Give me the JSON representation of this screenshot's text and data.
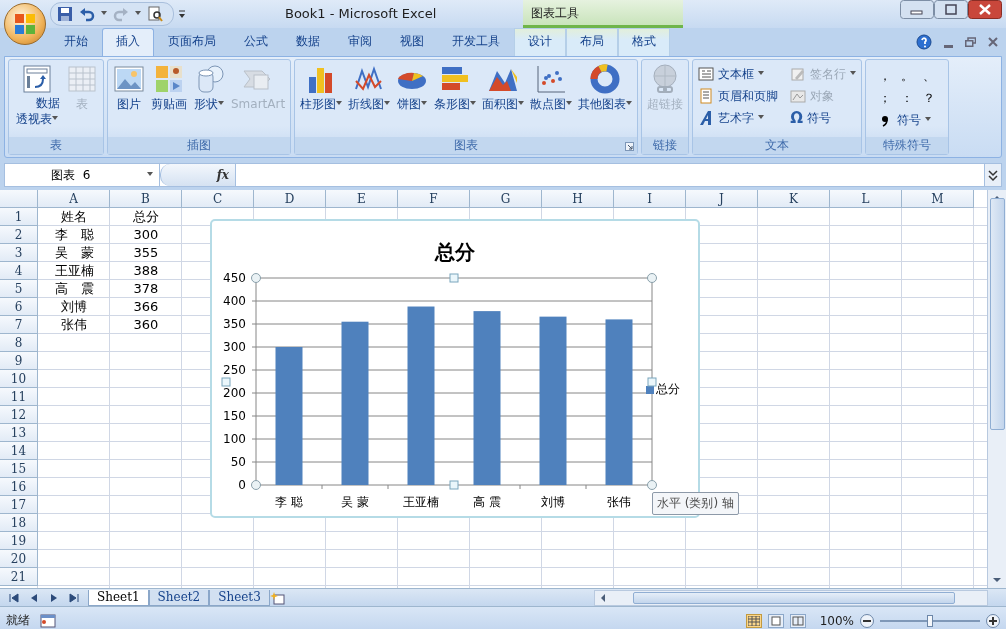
{
  "window": {
    "title": "Book1 - Microsoft Excel",
    "context_group": "图表工具"
  },
  "ribbon_tabs": [
    {
      "label": "开始",
      "selected": false,
      "contextual": false
    },
    {
      "label": "插入",
      "selected": true,
      "contextual": false
    },
    {
      "label": "页面布局",
      "selected": false,
      "contextual": false
    },
    {
      "label": "公式",
      "selected": false,
      "contextual": false
    },
    {
      "label": "数据",
      "selected": false,
      "contextual": false
    },
    {
      "label": "审阅",
      "selected": false,
      "contextual": false
    },
    {
      "label": "视图",
      "selected": false,
      "contextual": false
    },
    {
      "label": "开发工具",
      "selected": false,
      "contextual": false
    },
    {
      "label": "设计",
      "selected": false,
      "contextual": true
    },
    {
      "label": "布局",
      "selected": false,
      "contextual": true
    },
    {
      "label": "格式",
      "selected": false,
      "contextual": true
    }
  ],
  "ribbon_groups": [
    {
      "label": "表",
      "kind": "large",
      "buttons": [
        {
          "label": "数据透视表",
          "dropdown": true,
          "disabled": false
        },
        {
          "label": "表",
          "dropdown": false,
          "disabled": true
        }
      ]
    },
    {
      "label": "插图",
      "kind": "large",
      "buttons": [
        {
          "label": "图片",
          "dropdown": false,
          "disabled": false
        },
        {
          "label": "剪贴画",
          "dropdown": false,
          "disabled": false
        },
        {
          "label": "形状",
          "dropdown": true,
          "disabled": false
        },
        {
          "label": "SmartArt",
          "dropdown": false,
          "disabled": true
        }
      ]
    },
    {
      "label": "图表",
      "kind": "large",
      "launcher": true,
      "buttons": [
        {
          "label": "柱形图",
          "dropdown": true,
          "disabled": false
        },
        {
          "label": "折线图",
          "dropdown": true,
          "disabled": false
        },
        {
          "label": "饼图",
          "dropdown": true,
          "disabled": false
        },
        {
          "label": "条形图",
          "dropdown": true,
          "disabled": false
        },
        {
          "label": "面积图",
          "dropdown": true,
          "disabled": false
        },
        {
          "label": "散点图",
          "dropdown": true,
          "disabled": false
        },
        {
          "label": "其他图表",
          "dropdown": true,
          "disabled": false
        }
      ]
    },
    {
      "label": "链接",
      "kind": "large",
      "buttons": [
        {
          "label": "超链接",
          "dropdown": false,
          "disabled": true
        }
      ]
    },
    {
      "label": "文本",
      "kind": "small",
      "buttons": [
        {
          "label": "文本框",
          "dropdown": true,
          "disabled": false
        },
        {
          "label": "签名行",
          "dropdown": true,
          "disabled": true
        },
        {
          "label": "页眉和页脚",
          "dropdown": false,
          "disabled": false
        },
        {
          "label": "对象",
          "dropdown": false,
          "disabled": true
        },
        {
          "label": "艺术字",
          "dropdown": true,
          "disabled": false
        },
        {
          "label": "符号",
          "glyph": "Ω",
          "dropdown": false,
          "disabled": false
        }
      ]
    },
    {
      "label": "特殊符号",
      "kind": "symbols",
      "buttons": [
        {
          "label": "，"
        },
        {
          "label": "。"
        },
        {
          "label": "、"
        },
        {
          "label": "；"
        },
        {
          "label": "："
        },
        {
          "label": "？"
        },
        {
          "label": "符号",
          "dropdown": true
        }
      ]
    }
  ],
  "name_box": "图表  6",
  "formula_label": "fx",
  "columns": [
    "A",
    "B",
    "C",
    "D",
    "E",
    "F",
    "G",
    "H",
    "I",
    "J",
    "K",
    "L",
    "M"
  ],
  "rows": [
    {
      "number": "1",
      "cells": [
        "姓名",
        "总分"
      ]
    },
    {
      "number": "2",
      "cells": [
        "李　聪",
        "300"
      ]
    },
    {
      "number": "3",
      "cells": [
        "吴　蒙",
        "355"
      ]
    },
    {
      "number": "4",
      "cells": [
        "王亚楠",
        "388"
      ]
    },
    {
      "number": "5",
      "cells": [
        "高　震",
        "378"
      ]
    },
    {
      "number": "6",
      "cells": [
        "刘博",
        "366"
      ]
    },
    {
      "number": "7",
      "cells": [
        "张伟",
        "360"
      ]
    },
    {
      "number": "8"
    },
    {
      "number": "9"
    },
    {
      "number": "10"
    },
    {
      "number": "11"
    },
    {
      "number": "12"
    },
    {
      "number": "13"
    },
    {
      "number": "14"
    },
    {
      "number": "15"
    },
    {
      "number": "16"
    },
    {
      "number": "17"
    },
    {
      "number": "18"
    },
    {
      "number": "19"
    },
    {
      "number": "20"
    },
    {
      "number": "21"
    }
  ],
  "chart": {
    "tooltip": "水平 (类别) 轴",
    "chart_data": {
      "type": "bar",
      "grid": true,
      "title": "总分",
      "categories": [
        "李 聪",
        "吴 蒙",
        "王亚楠",
        "高 震",
        "刘博",
        "张伟"
      ],
      "series": [
        {
          "name": "总分",
          "color": "#4f81bd",
          "values": [
            300,
            355,
            388,
            378,
            366,
            360
          ]
        }
      ],
      "ylim": [
        0,
        450
      ],
      "yticks": [
        0,
        50,
        100,
        150,
        200,
        250,
        300,
        350,
        400,
        450
      ]
    }
  },
  "sheet_tabs": [
    {
      "label": "Sheet1",
      "selected": true
    },
    {
      "label": "Sheet2",
      "selected": false
    },
    {
      "label": "Sheet3",
      "selected": false
    }
  ],
  "status_bar": {
    "text": "就绪",
    "views": [
      {
        "selected": true
      },
      {
        "selected": false
      },
      {
        "selected": false
      }
    ],
    "zoom": "100%",
    "zoom_slider": {
      "level": 0.5
    }
  }
}
